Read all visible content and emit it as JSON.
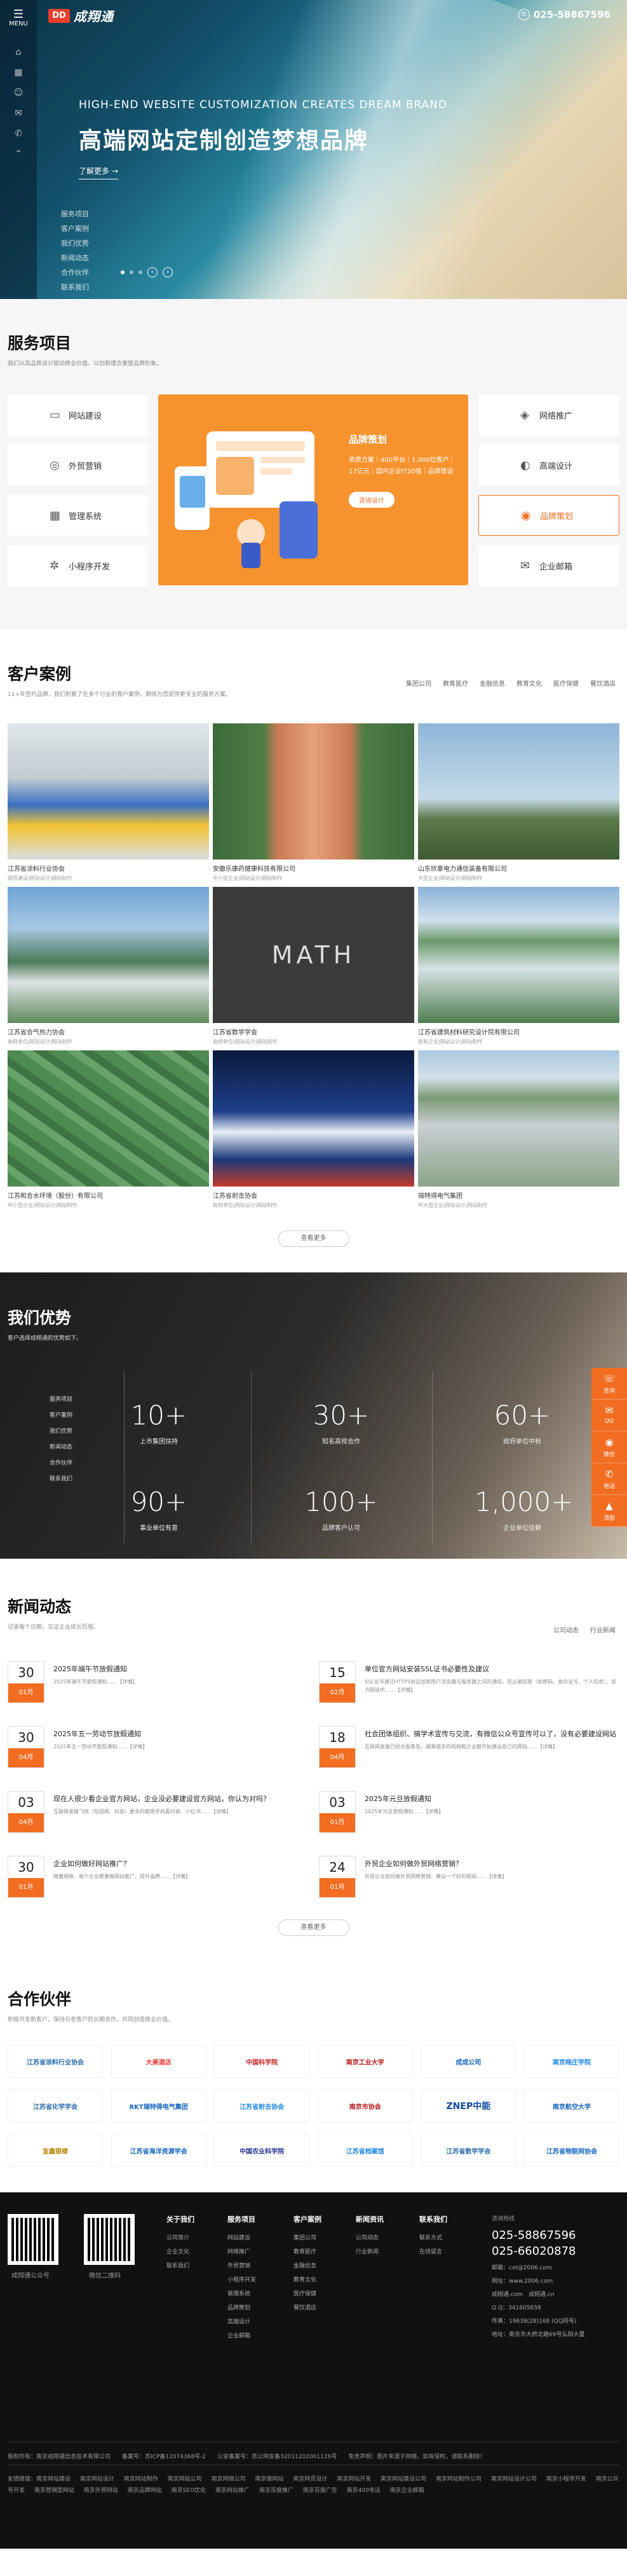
{
  "header": {
    "menu_label": "MENU",
    "logo_mark": "DD",
    "logo_text": "成翔通",
    "phone": "025-58867596"
  },
  "hero": {
    "title_en": "HIGH-END WEBSITE CUSTOMIZATION CREATES DREAM BRAND",
    "title_cn": "高端网站定制创造梦想品牌",
    "more": "了解更多 →",
    "nav": [
      "服务项目",
      "客户案例",
      "我们优势",
      "新闻动态",
      "合作伙伴",
      "联系我们"
    ]
  },
  "services": {
    "title": "服务项目",
    "desc": "我们以高品质设计驱动商业价值，以创新理念重塑品牌形象。",
    "items_left": [
      "网站建设",
      "外贸营销",
      "管理系统",
      "小程序开发"
    ],
    "items_right": [
      "网络推广",
      "高端设计",
      "品牌策划",
      "企业邮箱"
    ],
    "active_item": "品牌策划",
    "center_title": "品牌策划",
    "center_desc": "资质方案｜400平台｜1,000位客户｜17亿元｜国内企业IT30强｜品牌建设",
    "center_btn": "咨询设计"
  },
  "cases": {
    "title": "客户案例",
    "desc": "11+年签约品牌，我们积累了在多个行业的客户案例，期待为您提供更专业的服务方案。",
    "tabs": [
      "集团公司",
      "教育医疗",
      "金融信息",
      "教育文化",
      "医疗保健",
      "餐饮酒店"
    ],
    "items": [
      {
        "name": "江苏省涂料行业协会",
        "cat": "网页建设|网站设计|网站制作"
      },
      {
        "name": "安徽乐康药健康科技有限公司",
        "cat": "中小型企业|网站设计|网站制作"
      },
      {
        "name": "山东欣豪电力通信装备有限公司",
        "cat": "大型企业|网站设计|网站制作"
      },
      {
        "name": "江苏省合气热力协会",
        "cat": "政府单位|网站设计|网站制作"
      },
      {
        "name": "江苏省数学学会",
        "cat": "政府单位|网站设计|网站制作"
      },
      {
        "name": "江苏省建筑材料研究设计院有限公司",
        "cat": "国有企业|网站设计|网站制作"
      },
      {
        "name": "江苏和合水环境（股份）有限公司",
        "cat": "中小型企业|网站设计|网站制作"
      },
      {
        "name": "江苏省射击协会",
        "cat": "政府单位|网站设计|网站制作"
      },
      {
        "name": "瑞特得电气集团",
        "cat": "中大型企业|网站设计|网站制作"
      }
    ],
    "more": "查看更多"
  },
  "advantage": {
    "title": "我们优势",
    "desc": "客户选择成翔通的优势如下。",
    "menu": [
      "服务项目",
      "客户案例",
      "我们优势",
      "新闻动态",
      "合作伙伴",
      "联系我们"
    ],
    "stats": [
      {
        "value": "10+",
        "label": "上市集团扶持"
      },
      {
        "value": "30+",
        "label": "知名高校合作"
      },
      {
        "value": "60+",
        "label": "政府单位中标"
      },
      {
        "value": "90+",
        "label": "事业单位有意"
      },
      {
        "value": "100+",
        "label": "品牌客户认可"
      },
      {
        "value": "1,000+",
        "label": "企业单位信赖"
      }
    ],
    "float": [
      {
        "icon": "☏",
        "label": "咨询"
      },
      {
        "icon": "✉",
        "label": "QQ"
      },
      {
        "icon": "◉",
        "label": "微信"
      },
      {
        "icon": "✆",
        "label": "电话"
      },
      {
        "icon": "▲",
        "label": "顶部"
      }
    ]
  },
  "news": {
    "title": "新闻动态",
    "desc": "记录每个日期，见证企业成长历程。",
    "tabs": [
      "公司动态",
      "行业新闻"
    ],
    "items": [
      {
        "day": "30",
        "month": "01月",
        "title": "2025年端午节放假通知",
        "summary": "2025年端午节放假通知……【详情】"
      },
      {
        "day": "15",
        "month": "02月",
        "title": "单位官方网站安装SSL证书必要性及建议",
        "summary": "SSL证书通过HTTPS协议加密用户浏览器与服务器之间的通信，防止被窃取（如密码、身份证号、个人信息），官方网站中……【详情】"
      },
      {
        "day": "30",
        "month": "04月",
        "title": "2025年五一劳动节放假通知",
        "summary": "2025年五一劳动节放假通知……【详情】"
      },
      {
        "day": "18",
        "month": "04月",
        "title": "社会团体组织、搞学术宣传与交流，有微信公众号宣传可以了，没有必要建设网站",
        "summary": "互联网发展已经全面普及，越来越多的机构和企业都开始建设自己的网站……【详情】"
      },
      {
        "day": "03",
        "month": "04月",
        "title": "现在人很少看企业官方网站，企业没必要建设官方网站，你认为对吗？",
        "summary": "互联网发展飞快（短视频、抖音）更多的都用手机看抖音、小红书……【详情】"
      },
      {
        "day": "03",
        "month": "01月",
        "title": "2025年元旦放假通知",
        "summary": "2025年元旦放假通知……【详情】"
      },
      {
        "day": "30",
        "month": "01月",
        "title": "企业如何做好网站推广？",
        "summary": "随着网络，每个企业都要做网站推广，提升品牌……【详情】"
      },
      {
        "day": "24",
        "month": "01月",
        "title": "外贸企业如何做外贸网络营销？",
        "summary": "外贸企业如何做外贸网络营销，建设一个好的网站……【详情】"
      }
    ],
    "more": "查看更多"
  },
  "partners": {
    "title": "合作伙伴",
    "desc": "积极开发新客户，保持与老客户的长期合作，共同创造商业价值。",
    "row1": [
      "江苏省涂料行业协会",
      "大美酒店",
      "中国科学院",
      "南京工业大学",
      "成成公司",
      "南京晓庄学院"
    ],
    "row2": [
      "江苏省化学学会",
      "RKT瑞特得电气集团",
      "江苏省射击协会",
      "南京市协会",
      "ZNEP中能",
      "南京航空大学"
    ],
    "row3": [
      "宜鑫银楼",
      "江苏省海洋资源学会",
      "中国农业科学院",
      "江苏省档案馆",
      "江苏省数学学会",
      "江苏省物联网协会"
    ]
  },
  "footer": {
    "qr1": "成翔通公众号",
    "qr2": "微信二维码",
    "cols": [
      {
        "h": "关于我们",
        "items": [
          "公司简介",
          "企业文化",
          "联系我们"
        ]
      },
      {
        "h": "服务项目",
        "items": [
          "网站建设",
          "网络推广",
          "外贸营销",
          "小程序开发",
          "管理系统",
          "品牌策划",
          "高端设计",
          "企业邮箱"
        ]
      },
      {
        "h": "客户案例",
        "items": [
          "集团公司",
          "教育医疗",
          "金融信息",
          "教育文化",
          "医疗保健",
          "餐饮酒店"
        ]
      },
      {
        "h": "新闻资讯",
        "items": [
          "公司动态",
          "行业新闻"
        ]
      },
      {
        "h": "联系我们",
        "items": [
          "联系方式",
          "在线留言"
        ]
      }
    ],
    "contact_label": "咨询热线",
    "phone1": "025-58867596",
    "phone2": "025-66020878",
    "lines": [
      "邮箱：cxt@2006.com",
      "网址：www.2006.com",
      "成翔通.com　成翔通.cn",
      "Q  Q：341605658",
      "传真：19638(28)168 (QQ同号)",
      "地址：南京市大桥北路69号弘阳大厦"
    ],
    "copyright": "版权所有：南京成翔通信息技术有限公司　　备案号：苏ICP备12074368号-2　　公安备案号：苏公网安备32011202001126号　　免责声明：图片来源于网络，如有侵权，请联系删除！",
    "links": [
      "友情链接：南京网站建设",
      "南京网站设计",
      "南京网站制作",
      "南京网站公司",
      "南京网络公司",
      "南京做网站",
      "南京网页设计",
      "南京网站开发",
      "南京网站建设公司",
      "南京网站制作公司",
      "南京网站设计公司",
      "南京小程序开发",
      "南京公众号开发",
      "南京营销型网站",
      "南京外贸网站",
      "南京品牌网站",
      "南京SEO优化",
      "南京网站推广",
      "南京百度推广",
      "南京百度广告",
      "南京400电话",
      "南京企业邮箱"
    ]
  }
}
